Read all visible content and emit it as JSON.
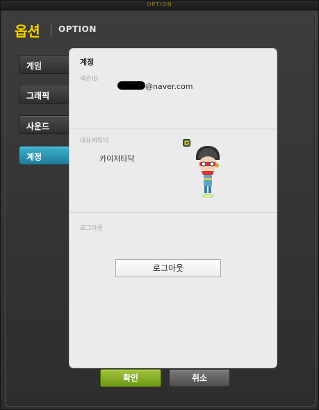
{
  "window": {
    "topbar_title": "OPTION",
    "title_ko": "옵션",
    "title_en": "OPTION"
  },
  "tabs": [
    {
      "label": "게임",
      "active": false
    },
    {
      "label": "그래픽",
      "active": false
    },
    {
      "label": "사운드",
      "active": false
    },
    {
      "label": "계정",
      "active": true
    }
  ],
  "panel": {
    "title": "계정",
    "nexon_id_label": "넥슨ID",
    "nexon_id_value": "@naver.com",
    "rep_character_label": "대표캐릭터",
    "rep_character_name": "카이저타닥",
    "logout_label": "로그아웃",
    "logout_button": "로그아웃"
  },
  "footer": {
    "confirm": "확인",
    "cancel": "취소"
  },
  "colors": {
    "accent_tab": "#2596b4",
    "title_yellow": "#f1d400",
    "confirm_green": "#86ad25",
    "cancel_gray": "#666666"
  }
}
